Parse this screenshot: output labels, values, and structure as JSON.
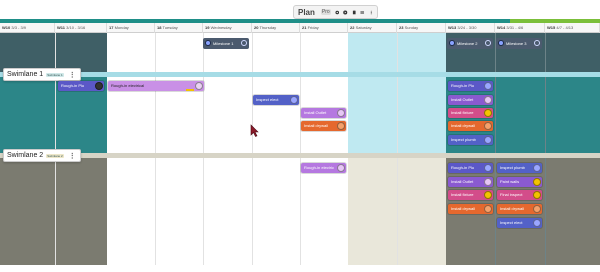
{
  "toolbar": {
    "title": "Plan",
    "badge": "Pro"
  },
  "header": {
    "cells": [
      {
        "label": "W10",
        "dates": "3/3 - 3/9"
      },
      {
        "label": "W11",
        "dates": "3/10 - 3/16"
      },
      {
        "label": "17",
        "dates": "Monday"
      },
      {
        "label": "18",
        "dates": "Tuesday"
      },
      {
        "label": "19",
        "dates": "Wednesday"
      },
      {
        "label": "20",
        "dates": "Thursday"
      },
      {
        "label": "21",
        "dates": "Friday"
      },
      {
        "label": "22",
        "dates": "Saturday"
      },
      {
        "label": "23",
        "dates": "Sunday"
      },
      {
        "label": "W13",
        "dates": "3/24 - 3/30"
      },
      {
        "label": "W14",
        "dates": "3/31 - 4/6"
      },
      {
        "label": "W15",
        "dates": "4/7 - 4/13"
      }
    ]
  },
  "swimlanes": [
    {
      "name": "Swimlane 1",
      "tag": "Swimlane 1"
    },
    {
      "name": "Swimlane 2",
      "tag": "Swimlane 2"
    }
  ],
  "milestones": [
    {
      "label": "Milestone 1"
    },
    {
      "label": "Milestone 2"
    },
    {
      "label": "Milestone 3"
    }
  ],
  "tasks": {
    "rough_plumbing": "Rough-in Plu",
    "rough_electrical": "Rough-in electrical",
    "inspect_electrical": "Inspect elect",
    "install_outlet": "Install Outlet",
    "install_drywall": "Install drywall",
    "rough_electric_2": "Rough-in electric",
    "install_outlet_2": "Install Outlet",
    "install_fixture": "Install fixture",
    "paint_walls": "Paint walls",
    "final_inspection": "Final inspect",
    "install_drywall_2": "Install drywall",
    "inspect_plumbing": "Inspect plumb"
  }
}
